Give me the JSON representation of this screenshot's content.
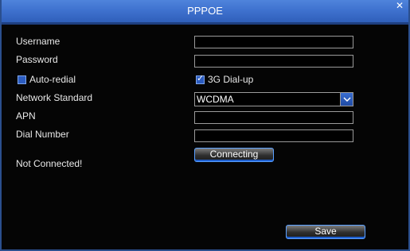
{
  "dialog": {
    "title": "PPPOE"
  },
  "icons": {
    "close": "close-icon",
    "dropdown": "chevron-down-icon",
    "check": "check-icon"
  },
  "fields": {
    "username_label": "Username",
    "username_value": "",
    "password_label": "Password",
    "password_value": "",
    "auto_redial_label": "Auto-redial",
    "auto_redial_checked": false,
    "dialup_3g_label": "3G Dial-up",
    "dialup_3g_checked": true,
    "network_standard_label": "Network Standard",
    "network_standard_value": "WCDMA",
    "apn_label": "APN",
    "apn_value": "",
    "dial_number_label": "Dial Number",
    "dial_number_value": ""
  },
  "actions": {
    "connecting_label": "Connecting",
    "save_label": "Save"
  },
  "status": {
    "text": "Not Connected!"
  },
  "colors": {
    "titlebar": "#3f72cf",
    "background": "#050505",
    "accent": "#2c5cc0",
    "text": "#e8e8e8"
  }
}
